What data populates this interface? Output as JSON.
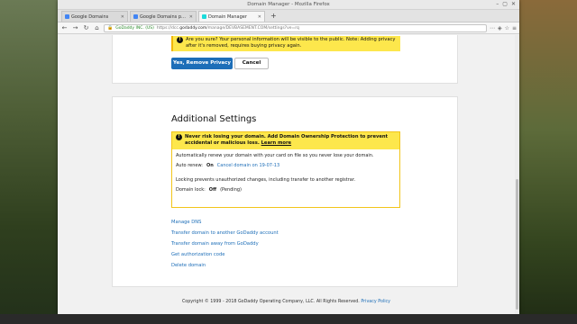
{
  "window": {
    "title": "Domain Manager - Mozilla Firefox"
  },
  "tabs": [
    {
      "label": "Google Domains",
      "favicon": "google-icon",
      "active": false
    },
    {
      "label": "Google Domains pricing and...",
      "favicon": "google-icon",
      "active": false
    },
    {
      "label": "Domain Manager",
      "favicon": "godaddy-icon",
      "active": true
    }
  ],
  "navbar": {
    "identity": "GoDaddy INC. (US)",
    "url_prefix": "https://dcc.",
    "url_host": "godaddy.com",
    "url_path": "/manage/DEVBASEMENT.COM/settings?ve=rq"
  },
  "privacy_card": {
    "warning_text": "Are you sure? Your personal information will be visible to the public. Note: Adding privacy after it's removed, requires buying privacy again.",
    "confirm_label": "Yes, Remove Privacy",
    "cancel_label": "Cancel"
  },
  "additional_settings": {
    "title": "Additional Settings",
    "warning_text": "Never risk losing your domain. Add Domain Ownership Protection to prevent accidental or malicious loss.",
    "learn_more": "Learn more",
    "auto_renew_desc": "Automatically renew your domain with your card on file so you never lose your domain.",
    "auto_renew_label": "Auto renew:",
    "auto_renew_value": "On",
    "cancel_renew": "Cancel domain on 19-07-13",
    "lock_desc": "Locking prevents unauthorized changes, including transfer to another registrar.",
    "lock_label": "Domain lock:",
    "lock_value": "Off",
    "lock_status": "(Pending)"
  },
  "links": [
    "Manage DNS",
    "Transfer domain to another GoDaddy account",
    "Transfer domain away from GoDaddy",
    "Get authorization code",
    "Delete domain"
  ],
  "footer": {
    "copyright": "Copyright © 1999 - 2018 GoDaddy Operating Company, LLC. All Rights Reserved.",
    "privacy_link": "Privacy Policy"
  },
  "colors": {
    "primary": "#1d6eb8",
    "warning_bg": "#fde74c",
    "link": "#1d6eb8"
  }
}
